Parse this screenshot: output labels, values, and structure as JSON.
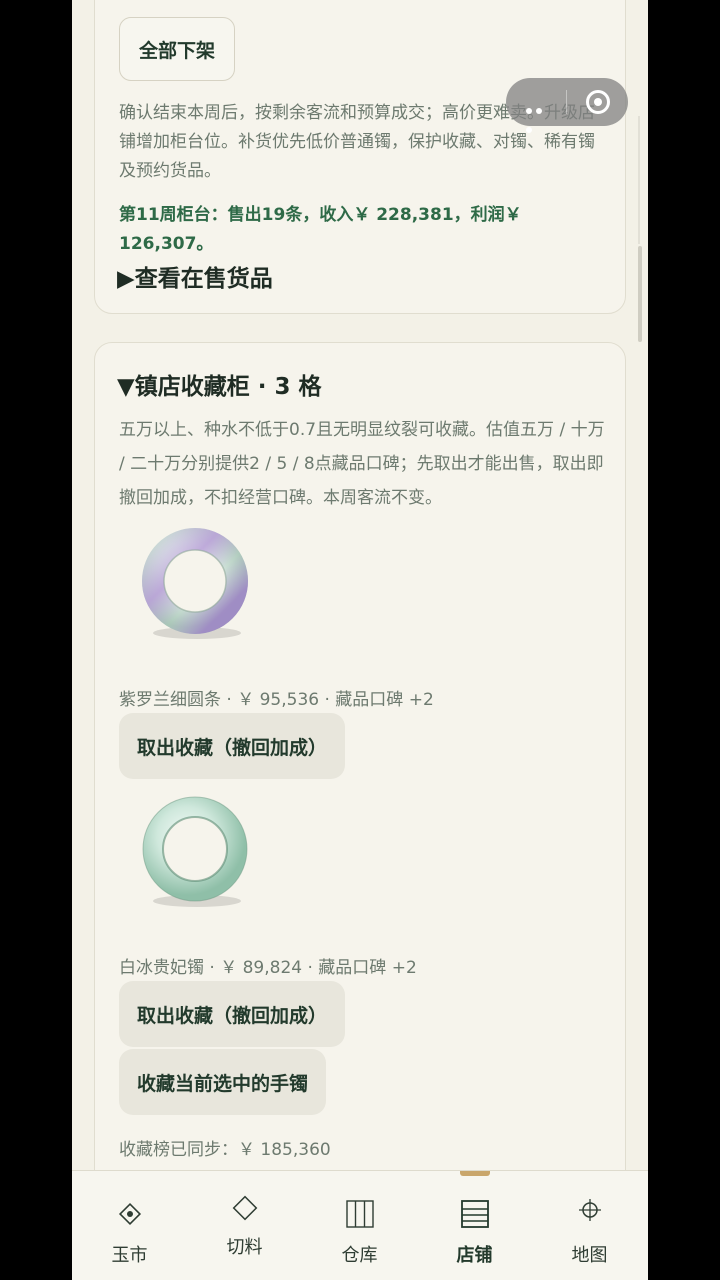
{
  "card_top": {
    "button_label": "全部下架",
    "description": "确认结束本周后，按剩余客流和预算成交；高价更难卖。升级店铺增加柜台位。补货优先低价普通镯，保护收藏、对镯、稀有镯及预约货品。",
    "week_summary": "第11周柜台：售出19条，收入￥ 228,381，利润￥ 126,307。",
    "toggle_label": "▶查看在售货品"
  },
  "collection": {
    "heading": "▼镇店收藏柜 · 3 格",
    "description": "五万以上、种水不低于0.7且无明显纹裂可收藏。估值五万 / 十万 / 二十万分别提供2 / 5 / 8点藏品口碑；先取出才能出售，取出即撤回加成，不扣经营口碑。本周客流不变。",
    "items": [
      {
        "name_line": "紫罗兰细圆条 · ￥ 95,536 · 藏品口碑 +2",
        "button_label": "取出收藏（撤回加成）",
        "colors": {
          "base": "#dfeee6",
          "accent": "#b79ad8"
        }
      },
      {
        "name_line": "白冰贵妃镯 · ￥ 89,824 · 藏品口碑 +2",
        "button_label": "取出收藏（撤回加成）",
        "colors": {
          "base": "#cfe8dc",
          "accent": "#8fbfa8"
        }
      }
    ],
    "collect_button_label": "收藏当前选中的手镯",
    "sync_text": "收藏榜已同步：￥ 185,360"
  },
  "tabbar": {
    "tabs": [
      {
        "label": "玉市",
        "icon": "diamond-dot-icon",
        "active": false
      },
      {
        "label": "切料",
        "icon": "diamond-outline-icon",
        "active": false
      },
      {
        "label": "仓库",
        "icon": "shelves-icon",
        "active": false
      },
      {
        "label": "店铺",
        "icon": "store-list-icon",
        "active": true
      },
      {
        "label": "地图",
        "icon": "crosshair-icon",
        "active": false
      }
    ]
  },
  "colors": {
    "background": "#f3f1e7",
    "accent_green": "#2e6a47",
    "active_indicator": "#c9a66b"
  }
}
